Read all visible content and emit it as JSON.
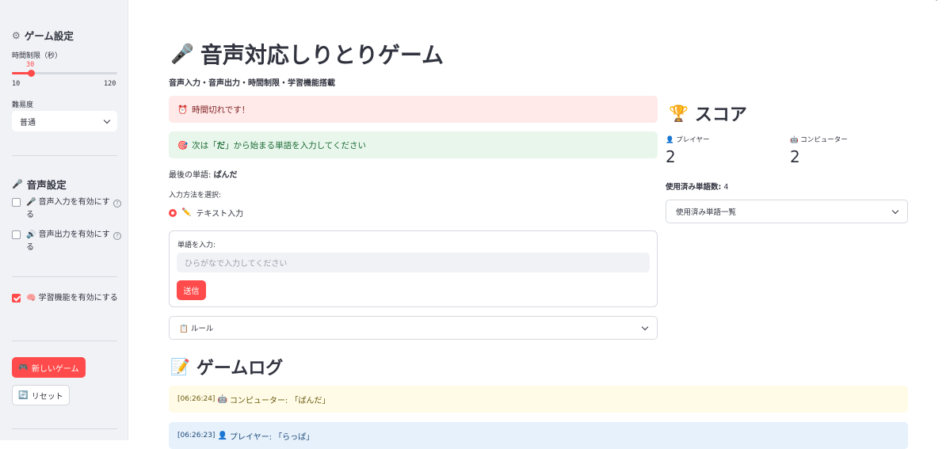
{
  "sidebar": {
    "game_settings_heading": "ゲーム設定",
    "time_limit_label": "時間制限（秒）",
    "time_limit_value": "30",
    "time_limit_min": "10",
    "time_limit_max": "120",
    "time_limit_fraction": 0.18,
    "difficulty_label": "難易度",
    "difficulty_selected": "普通",
    "voice_settings_heading": "音声設定",
    "voice_input_label": "音声入力を有効にする",
    "voice_output_label": "音声出力を有効にする",
    "learning_label": "学習機能を有効にする",
    "new_game_button": "新しいゲーム",
    "reset_button": "リセット"
  },
  "main": {
    "title": "音声対応しりとりゲーム",
    "subtitle": "音声入力・音声出力・時間制限・学習機能搭載",
    "timeout_alert": "時間切れです！",
    "next_prefix": "次は「",
    "next_char": "だ",
    "next_suffix": "」から始まる単語を入力してください",
    "last_word_label": "最後の単語:",
    "last_word_value": "ぱんだ",
    "input_method_label": "入力方法を選択:",
    "input_method_option": "テキスト入力",
    "word_input_label": "単語を入力:",
    "word_input_placeholder": "ひらがなで入力してください",
    "submit_button": "送信",
    "rules_expander": "ルール",
    "game_log_heading": "ゲームログ"
  },
  "score": {
    "heading": "スコア",
    "player_label": "プレイヤー",
    "player_value": "2",
    "computer_label": "コンピューター",
    "computer_value": "2",
    "used_words_label": "使用済み単語数:",
    "used_words_count": "4",
    "used_words_expander": "使用済み単語一覧"
  },
  "log": [
    {
      "time": "[06:26:24]",
      "text": "コンピューター: 「ぱんだ」"
    },
    {
      "time": "[06:26:23]",
      "text": "プレイヤー: 「らっぱ」"
    }
  ],
  "colors": {
    "accent": "#ff4b4b",
    "sidebar_bg": "#f0f2f6",
    "error_bg": "#ffe9e9",
    "success_bg": "#e8f6ec",
    "warning_bg": "#fffbe6",
    "info_bg": "#e7f1fb"
  }
}
